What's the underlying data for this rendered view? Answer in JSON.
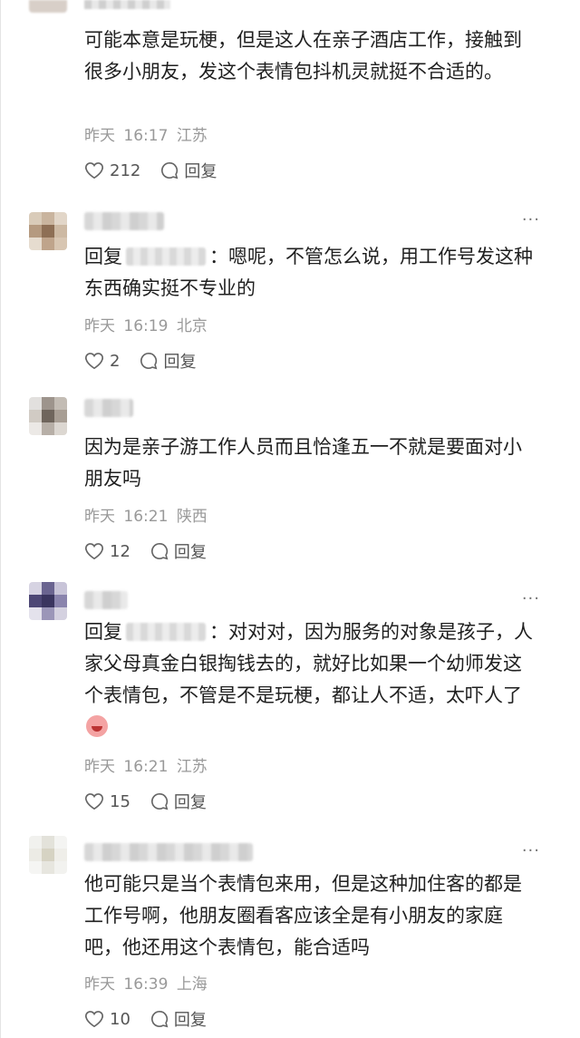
{
  "comments": [
    {
      "text": "可能本意是玩梗，但是这人在亲子酒店工作，接触到很多小朋友，发这个表情包抖机灵就挺不合适的。",
      "date": "昨天",
      "time": "16:17",
      "location": "江苏",
      "likes": "212",
      "reply_label": "回复"
    },
    {
      "reply_prefix": "回复",
      "text": "：嗯呢，不管怎么说，用工作号发这种东西确实挺不专业的",
      "date": "昨天",
      "time": "16:19",
      "location": "北京",
      "likes": "2",
      "reply_label": "回复"
    },
    {
      "text": "因为是亲子游工作人员而且恰逢五一不就是要面对小朋友吗",
      "date": "昨天",
      "time": "16:21",
      "location": "陕西",
      "likes": "12",
      "reply_label": "回复"
    },
    {
      "reply_prefix": "回复",
      "text": "：对对对，因为服务的对象是孩子，人家父母真金白银掏钱去的，就好比如果一个幼师发这个表情包，不管是不是玩梗，都让人不适，太吓人了",
      "date": "昨天",
      "time": "16:21",
      "location": "江苏",
      "likes": "15",
      "reply_label": "回复"
    },
    {
      "text": "他可能只是当个表情包来用，但是这种加住客的都是工作号啊，他朋友圈看客应该全是有小朋友的家庭吧，他还用这个表情包，能合适吗",
      "date": "昨天",
      "time": "16:39",
      "location": "上海",
      "likes": "10",
      "reply_label": "回复"
    }
  ],
  "more_glyph": "···",
  "icons": {
    "like": "heart-outline-icon",
    "reply": "speech-bubble-icon",
    "more": "more-dots-icon"
  },
  "colors": {
    "meta": "#999999",
    "text": "#1f1f1f"
  }
}
